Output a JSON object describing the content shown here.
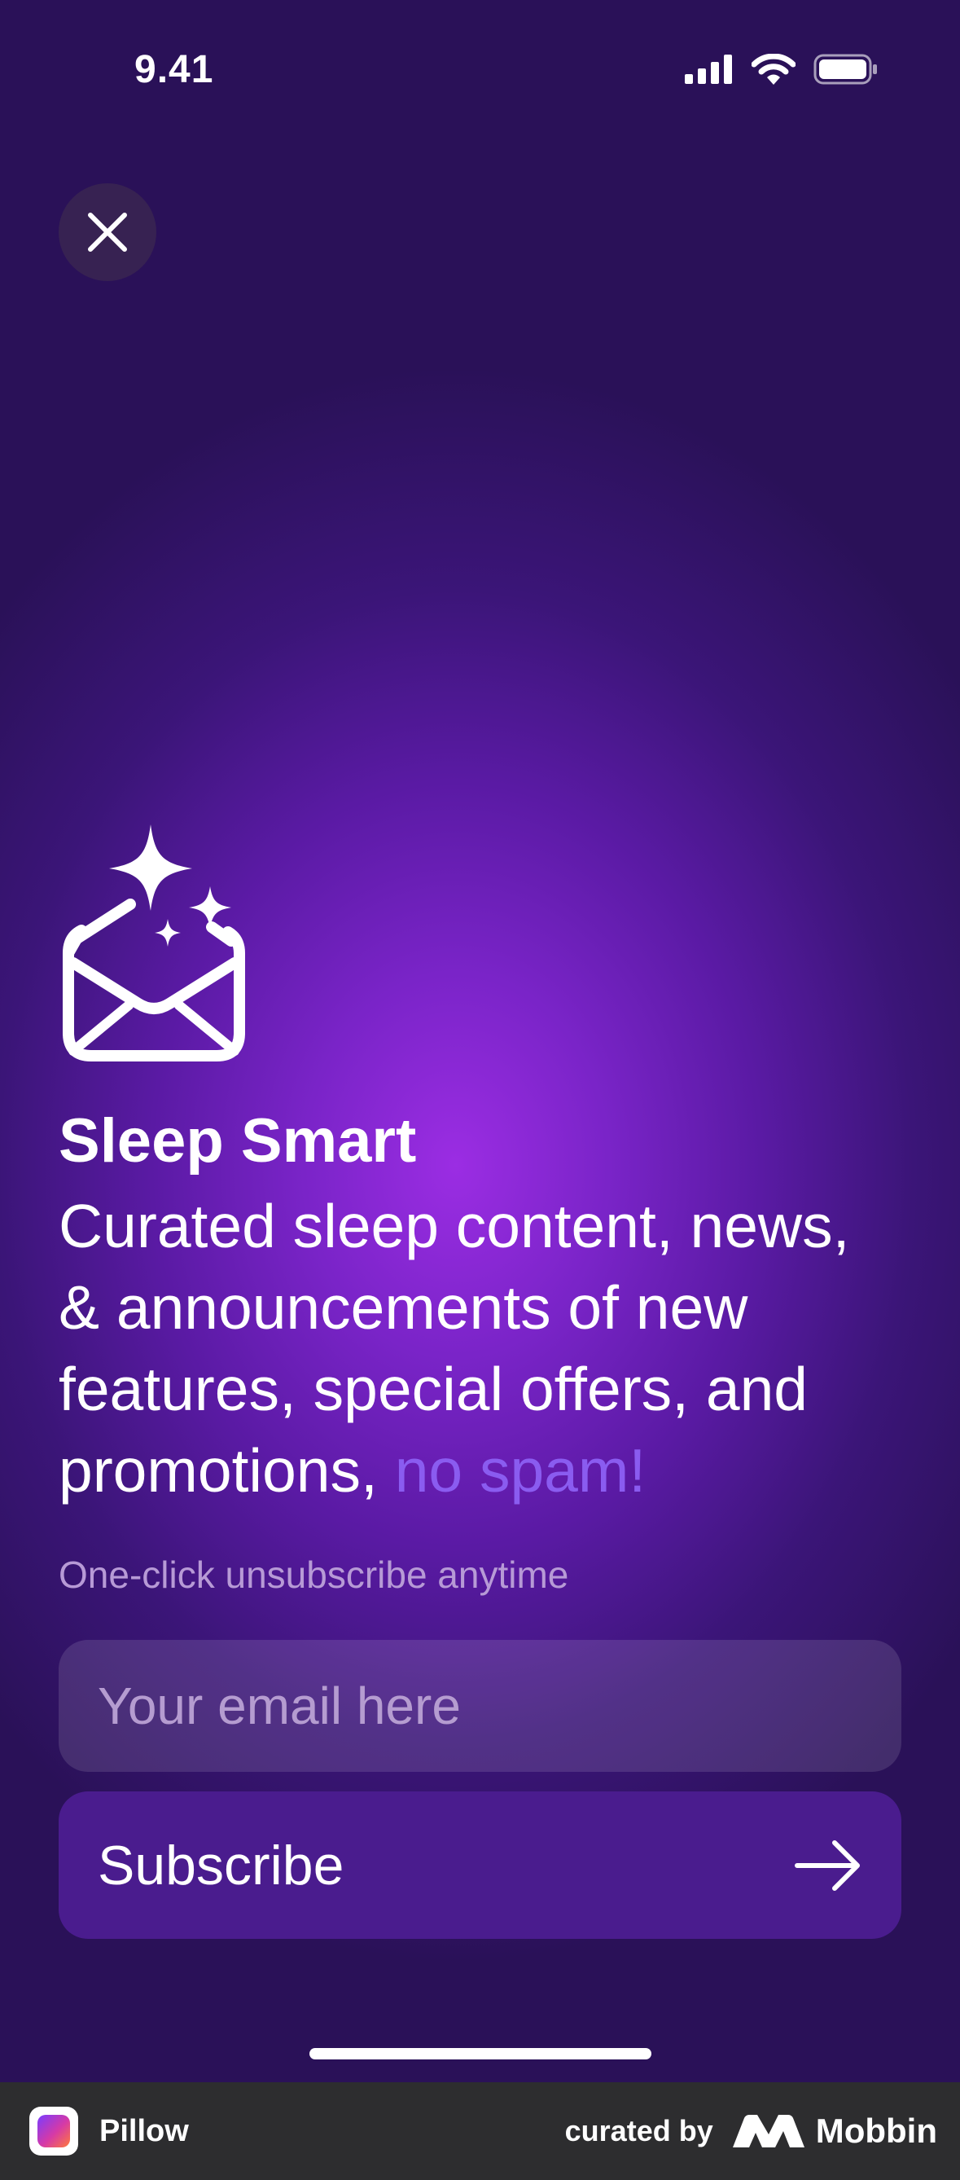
{
  "status_bar": {
    "time": "9.41"
  },
  "close_button": {
    "icon": "close-icon"
  },
  "hero": {
    "icon": "envelope-sparkles-icon",
    "title": "Sleep Smart",
    "description": "Curated sleep content, news, & announcements of new features, special offers, and promotions,",
    "highlight": "no spam!",
    "highlight_color": "#8a5cf0"
  },
  "form": {
    "note": "One-click unsubscribe anytime",
    "email_placeholder": "Your email here",
    "email_value": "",
    "subscribe_label": "Subscribe",
    "subscribe_icon": "arrow-right-icon"
  },
  "branding": {
    "app_name": "Pillow",
    "curated_by": "curated by",
    "curator": "Mobbin"
  },
  "colors": {
    "background_top": "#2a1158",
    "background_glow": "#9b2de3",
    "button_bg": "#4a1c8e",
    "brand_bar": "#2d2d2f"
  }
}
